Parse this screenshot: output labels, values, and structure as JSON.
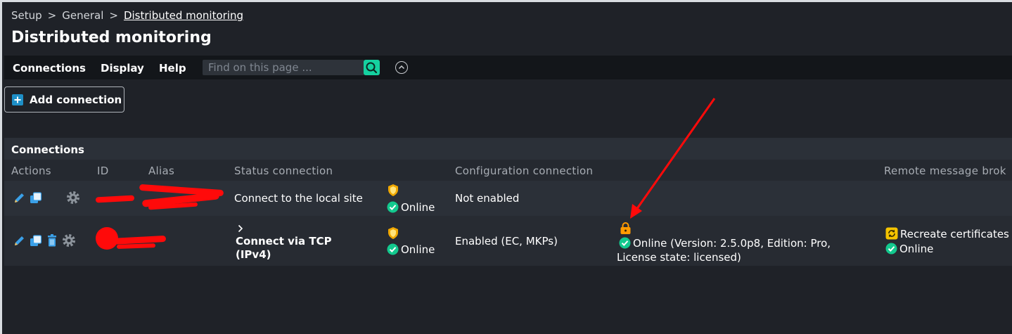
{
  "breadcrumb": {
    "items": [
      "Setup",
      "General"
    ],
    "current": "Distributed monitoring"
  },
  "page_title": "Distributed monitoring",
  "menubar": {
    "items": [
      "Connections",
      "Display",
      "Help"
    ],
    "search_placeholder": "Find on this page ..."
  },
  "add_connection_label": "Add connection",
  "section_title": "Connections",
  "columns": [
    "Actions",
    "ID",
    "Alias",
    "Status connection",
    "Configuration connection",
    "Remote message brok"
  ],
  "rows": [
    {
      "status_connection": "Connect to the local site",
      "status": "Online",
      "configuration": "Not enabled"
    },
    {
      "status_connection_line1": "Connect via TCP",
      "status_connection_line2": "(IPv4)",
      "status": "Online",
      "configuration": "Enabled (EC, MKPs)",
      "site_status_line1": "Online (Version: 2.5.0p8, Edition: Pro,",
      "site_status_line2": "License state: licensed)",
      "broker_action": "Recreate certificates",
      "broker_status": "Online"
    }
  ],
  "colors": {
    "accent": "#15d1a0",
    "ok": "#13c98e",
    "warning": "#ff9a00",
    "annotation": "#ff0a0a"
  },
  "icons": [
    "pencil-icon",
    "clone-icon",
    "gear-icon",
    "trash-icon",
    "shield-icon",
    "check-circle-icon",
    "lock-icon",
    "refresh-icon",
    "search-icon",
    "chevron-up-icon",
    "plus-icon",
    "chevron-right-icon"
  ]
}
